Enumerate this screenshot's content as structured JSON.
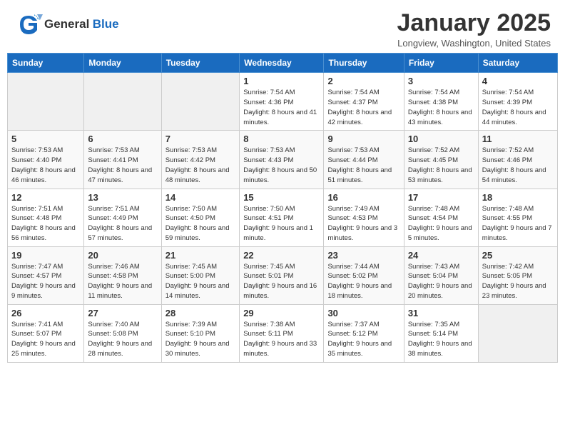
{
  "header": {
    "logo_general": "General",
    "logo_blue": "Blue",
    "title": "January 2025",
    "location": "Longview, Washington, United States"
  },
  "calendar": {
    "columns": [
      "Sunday",
      "Monday",
      "Tuesday",
      "Wednesday",
      "Thursday",
      "Friday",
      "Saturday"
    ],
    "rows": [
      [
        {
          "day": "",
          "info": ""
        },
        {
          "day": "",
          "info": ""
        },
        {
          "day": "",
          "info": ""
        },
        {
          "day": "1",
          "info": "Sunrise: 7:54 AM\nSunset: 4:36 PM\nDaylight: 8 hours and 41 minutes."
        },
        {
          "day": "2",
          "info": "Sunrise: 7:54 AM\nSunset: 4:37 PM\nDaylight: 8 hours and 42 minutes."
        },
        {
          "day": "3",
          "info": "Sunrise: 7:54 AM\nSunset: 4:38 PM\nDaylight: 8 hours and 43 minutes."
        },
        {
          "day": "4",
          "info": "Sunrise: 7:54 AM\nSunset: 4:39 PM\nDaylight: 8 hours and 44 minutes."
        }
      ],
      [
        {
          "day": "5",
          "info": "Sunrise: 7:53 AM\nSunset: 4:40 PM\nDaylight: 8 hours and 46 minutes."
        },
        {
          "day": "6",
          "info": "Sunrise: 7:53 AM\nSunset: 4:41 PM\nDaylight: 8 hours and 47 minutes."
        },
        {
          "day": "7",
          "info": "Sunrise: 7:53 AM\nSunset: 4:42 PM\nDaylight: 8 hours and 48 minutes."
        },
        {
          "day": "8",
          "info": "Sunrise: 7:53 AM\nSunset: 4:43 PM\nDaylight: 8 hours and 50 minutes."
        },
        {
          "day": "9",
          "info": "Sunrise: 7:53 AM\nSunset: 4:44 PM\nDaylight: 8 hours and 51 minutes."
        },
        {
          "day": "10",
          "info": "Sunrise: 7:52 AM\nSunset: 4:45 PM\nDaylight: 8 hours and 53 minutes."
        },
        {
          "day": "11",
          "info": "Sunrise: 7:52 AM\nSunset: 4:46 PM\nDaylight: 8 hours and 54 minutes."
        }
      ],
      [
        {
          "day": "12",
          "info": "Sunrise: 7:51 AM\nSunset: 4:48 PM\nDaylight: 8 hours and 56 minutes."
        },
        {
          "day": "13",
          "info": "Sunrise: 7:51 AM\nSunset: 4:49 PM\nDaylight: 8 hours and 57 minutes."
        },
        {
          "day": "14",
          "info": "Sunrise: 7:50 AM\nSunset: 4:50 PM\nDaylight: 8 hours and 59 minutes."
        },
        {
          "day": "15",
          "info": "Sunrise: 7:50 AM\nSunset: 4:51 PM\nDaylight: 9 hours and 1 minute."
        },
        {
          "day": "16",
          "info": "Sunrise: 7:49 AM\nSunset: 4:53 PM\nDaylight: 9 hours and 3 minutes."
        },
        {
          "day": "17",
          "info": "Sunrise: 7:48 AM\nSunset: 4:54 PM\nDaylight: 9 hours and 5 minutes."
        },
        {
          "day": "18",
          "info": "Sunrise: 7:48 AM\nSunset: 4:55 PM\nDaylight: 9 hours and 7 minutes."
        }
      ],
      [
        {
          "day": "19",
          "info": "Sunrise: 7:47 AM\nSunset: 4:57 PM\nDaylight: 9 hours and 9 minutes."
        },
        {
          "day": "20",
          "info": "Sunrise: 7:46 AM\nSunset: 4:58 PM\nDaylight: 9 hours and 11 minutes."
        },
        {
          "day": "21",
          "info": "Sunrise: 7:45 AM\nSunset: 5:00 PM\nDaylight: 9 hours and 14 minutes."
        },
        {
          "day": "22",
          "info": "Sunrise: 7:45 AM\nSunset: 5:01 PM\nDaylight: 9 hours and 16 minutes."
        },
        {
          "day": "23",
          "info": "Sunrise: 7:44 AM\nSunset: 5:02 PM\nDaylight: 9 hours and 18 minutes."
        },
        {
          "day": "24",
          "info": "Sunrise: 7:43 AM\nSunset: 5:04 PM\nDaylight: 9 hours and 20 minutes."
        },
        {
          "day": "25",
          "info": "Sunrise: 7:42 AM\nSunset: 5:05 PM\nDaylight: 9 hours and 23 minutes."
        }
      ],
      [
        {
          "day": "26",
          "info": "Sunrise: 7:41 AM\nSunset: 5:07 PM\nDaylight: 9 hours and 25 minutes."
        },
        {
          "day": "27",
          "info": "Sunrise: 7:40 AM\nSunset: 5:08 PM\nDaylight: 9 hours and 28 minutes."
        },
        {
          "day": "28",
          "info": "Sunrise: 7:39 AM\nSunset: 5:10 PM\nDaylight: 9 hours and 30 minutes."
        },
        {
          "day": "29",
          "info": "Sunrise: 7:38 AM\nSunset: 5:11 PM\nDaylight: 9 hours and 33 minutes."
        },
        {
          "day": "30",
          "info": "Sunrise: 7:37 AM\nSunset: 5:12 PM\nDaylight: 9 hours and 35 minutes."
        },
        {
          "day": "31",
          "info": "Sunrise: 7:35 AM\nSunset: 5:14 PM\nDaylight: 9 hours and 38 minutes."
        },
        {
          "day": "",
          "info": ""
        }
      ]
    ]
  }
}
